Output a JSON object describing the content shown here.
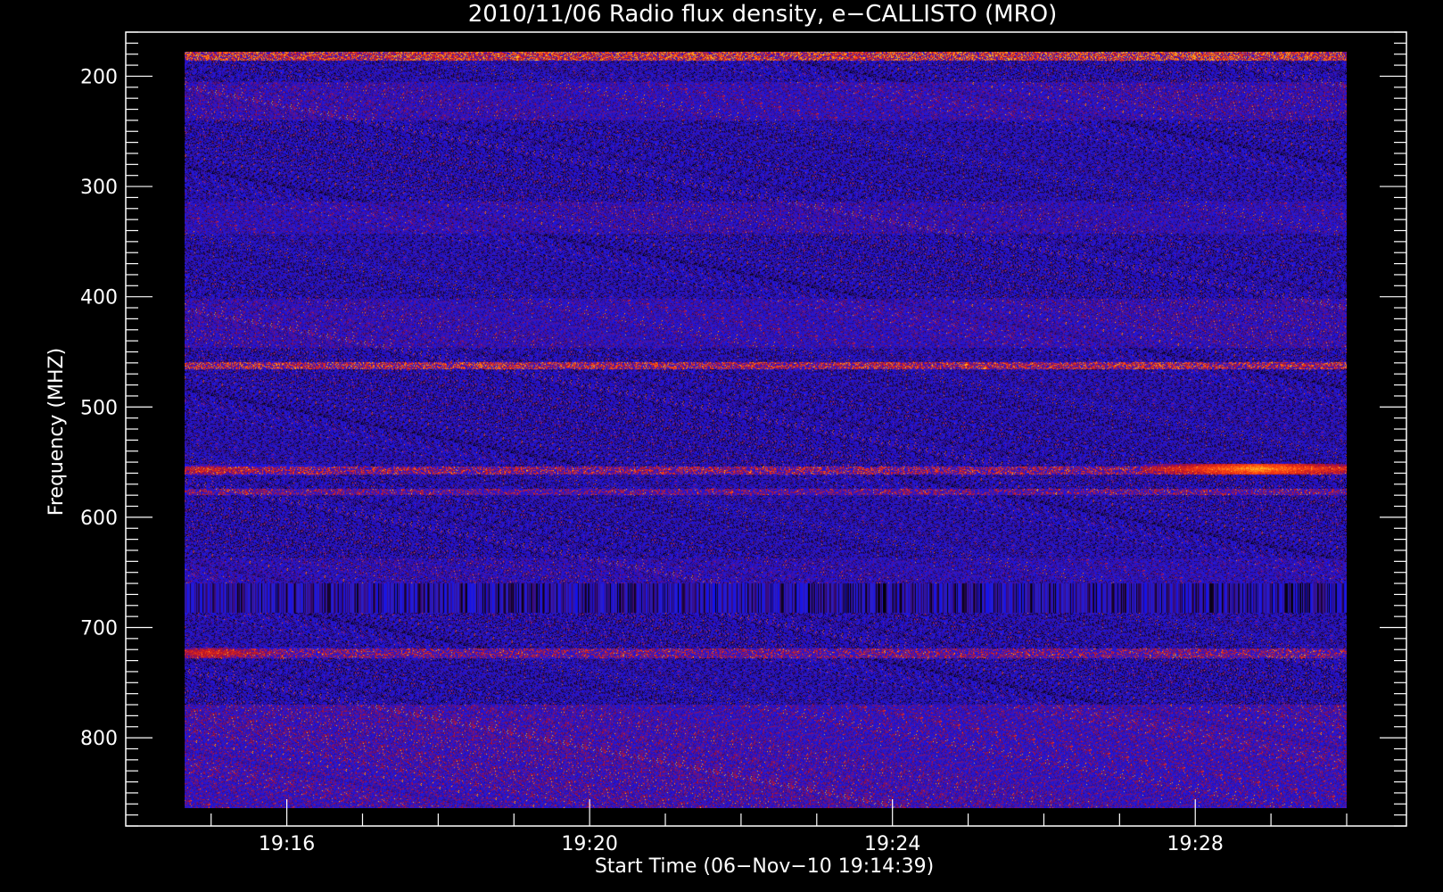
{
  "chart_data": {
    "type": "heatmap",
    "title": "2010/11/06  Radio flux density, e−CALLISTO (MRO)",
    "xlabel": "Start Time (06−Nov−10 19:14:39)",
    "ylabel": "Frequency (MHZ)",
    "x_ticks": [
      "19:16",
      "19:20",
      "19:24",
      "19:28"
    ],
    "x_tick_values": [
      16,
      20,
      24,
      28
    ],
    "x_range_minutes": [
      14.65,
      30.0
    ],
    "x_minor_step": 1,
    "y_ticks": [
      "200",
      "300",
      "400",
      "500",
      "600",
      "700",
      "800"
    ],
    "y_tick_values": [
      200,
      300,
      400,
      500,
      600,
      700,
      800
    ],
    "y_axis_range": [
      160,
      880
    ],
    "y_data_range": [
      177,
      875
    ],
    "y_minor_step": 10,
    "y_inverted": true,
    "colormap": [
      "#000000",
      "#3a0b7a",
      "#2a1ecc",
      "#1010f0",
      "#b5102a",
      "#ff4010",
      "#ffd020"
    ],
    "background_level": 0.28,
    "bands": [
      {
        "f_min": 177,
        "f_max": 185,
        "intensity": 0.72,
        "note": "noisy top edge"
      },
      {
        "f_min": 205,
        "f_max": 240,
        "intensity": 0.38
      },
      {
        "f_min": 315,
        "f_max": 345,
        "intensity": 0.36
      },
      {
        "f_min": 405,
        "f_max": 450,
        "intensity": 0.37
      },
      {
        "f_min": 463,
        "f_max": 470,
        "intensity": 0.66
      },
      {
        "f_min": 560,
        "f_max": 567,
        "intensity": 0.6
      },
      {
        "f_min": 580,
        "f_max": 586,
        "intensity": 0.52
      },
      {
        "f_min": 645,
        "f_max": 668,
        "intensity": 0.34,
        "note": "strong blue band"
      },
      {
        "f_min": 668,
        "f_max": 695,
        "intensity": 0.25,
        "note": "vertical striping"
      },
      {
        "f_min": 728,
        "f_max": 737,
        "intensity": 0.55
      },
      {
        "f_min": 780,
        "f_max": 875,
        "intensity": 0.42
      }
    ],
    "bursts": [
      {
        "time_min": 28.8,
        "f": 562,
        "intensity": 0.95
      },
      {
        "time_min": 15.0,
        "f": 732,
        "intensity": 0.75
      },
      {
        "time_min": 15.0,
        "f": 563,
        "intensity": 0.7
      }
    ]
  }
}
